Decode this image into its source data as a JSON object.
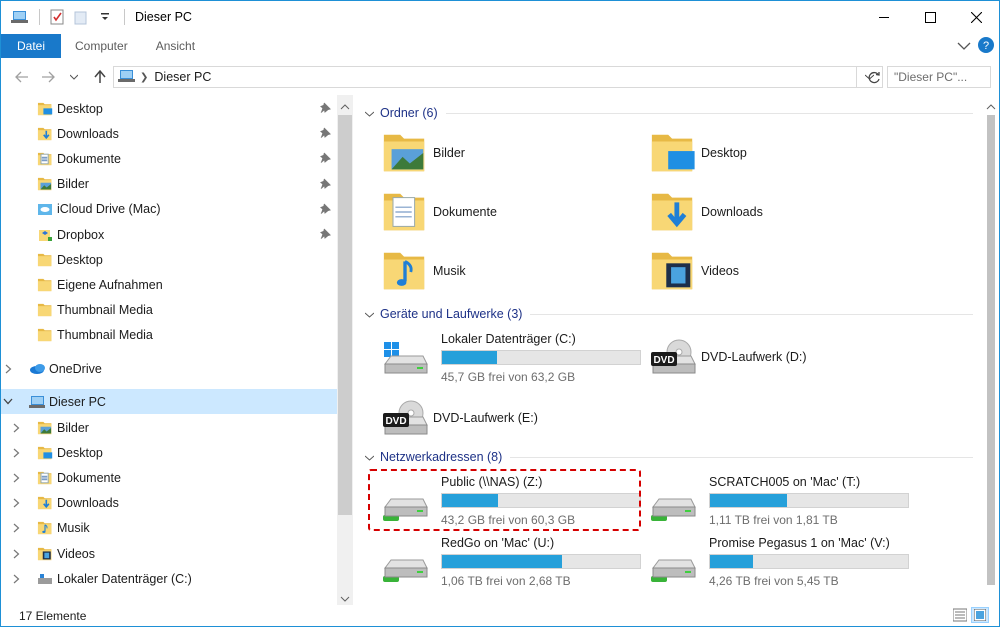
{
  "window": {
    "title": "Dieser PC"
  },
  "ribbon": {
    "file_tab": "Datei",
    "tabs": [
      "Computer",
      "Ansicht"
    ]
  },
  "address": {
    "crumb": "Dieser PC",
    "search_placeholder": "\"Dieser PC\"..."
  },
  "nav": {
    "quick_access": [
      {
        "label": "Desktop",
        "icon": "folder-blue-icon",
        "pinned": true
      },
      {
        "label": "Downloads",
        "icon": "downloads-folder-icon",
        "pinned": true
      },
      {
        "label": "Dokumente",
        "icon": "documents-folder-icon",
        "pinned": true
      },
      {
        "label": "Bilder",
        "icon": "pictures-folder-icon",
        "pinned": true
      },
      {
        "label": "iCloud Drive (Mac)",
        "icon": "icloud-folder-icon",
        "pinned": true
      },
      {
        "label": "Dropbox",
        "icon": "dropbox-folder-icon",
        "pinned": true
      },
      {
        "label": "Desktop",
        "icon": "folder-icon",
        "pinned": false
      },
      {
        "label": "Eigene Aufnahmen",
        "icon": "folder-icon",
        "pinned": false
      },
      {
        "label": "Thumbnail Media",
        "icon": "folder-icon",
        "pinned": false
      },
      {
        "label": "Thumbnail Media",
        "icon": "folder-icon",
        "pinned": false
      }
    ],
    "onedrive": "OneDrive",
    "this_pc": "Dieser PC",
    "pc_children": [
      {
        "label": "Bilder",
        "icon": "pictures-folder-icon"
      },
      {
        "label": "Desktop",
        "icon": "folder-blue-icon"
      },
      {
        "label": "Dokumente",
        "icon": "documents-folder-icon"
      },
      {
        "label": "Downloads",
        "icon": "downloads-folder-icon"
      },
      {
        "label": "Musik",
        "icon": "music-folder-icon"
      },
      {
        "label": "Videos",
        "icon": "videos-folder-icon"
      },
      {
        "label": "Lokaler Datenträger (C:)",
        "icon": "drive-icon"
      }
    ]
  },
  "groups": {
    "folders": {
      "title": "Ordner (6)",
      "items": [
        "Bilder",
        "Desktop",
        "Dokumente",
        "Downloads",
        "Musik",
        "Videos"
      ]
    },
    "devices": {
      "title": "Geräte und Laufwerke (3)",
      "items": [
        {
          "name": "Lokaler Datenträger (C:)",
          "free": "45,7 GB frei von 63,2 GB",
          "used_fraction": 0.277
        },
        {
          "name": "DVD-Laufwerk (D:)"
        },
        {
          "name": "DVD-Laufwerk (E:)"
        }
      ]
    },
    "network": {
      "title": "Netzwerkadressen (8)",
      "items": [
        {
          "name": "Public (\\\\NAS) (Z:)",
          "free": "43,2 GB frei von 60,3 GB",
          "used_fraction": 0.284,
          "highlighted": true
        },
        {
          "name": "SCRATCH005 on 'Mac' (T:)",
          "free": "1,11 TB frei von 1,81 TB",
          "used_fraction": 0.387
        },
        {
          "name": "RedGo on 'Mac' (U:)",
          "free": "1,06 TB frei von 2,68 TB",
          "used_fraction": 0.604
        },
        {
          "name": "Promise Pegasus 1 on 'Mac' (V:)",
          "free": "4,26 TB frei von 5,45 TB",
          "used_fraction": 0.218
        }
      ]
    }
  },
  "status": {
    "count": "17 Elemente"
  },
  "colors": {
    "accent": "#1979ca",
    "bar_fill": "#26a0da",
    "highlight": "#d50000",
    "group_title": "#1e3287"
  }
}
